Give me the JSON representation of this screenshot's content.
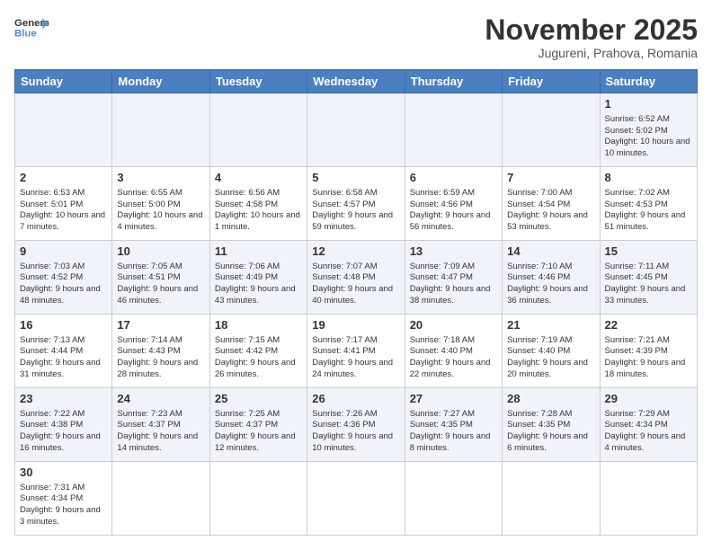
{
  "header": {
    "logo_general": "General",
    "logo_blue": "Blue",
    "month_title": "November 2025",
    "location": "Jugureni, Prahova, Romania"
  },
  "weekdays": [
    "Sunday",
    "Monday",
    "Tuesday",
    "Wednesday",
    "Thursday",
    "Friday",
    "Saturday"
  ],
  "weeks": [
    [
      {
        "day": "",
        "info": ""
      },
      {
        "day": "",
        "info": ""
      },
      {
        "day": "",
        "info": ""
      },
      {
        "day": "",
        "info": ""
      },
      {
        "day": "",
        "info": ""
      },
      {
        "day": "",
        "info": ""
      },
      {
        "day": "1",
        "info": "Sunrise: 6:52 AM\nSunset: 5:02 PM\nDaylight: 10 hours and 10 minutes."
      }
    ],
    [
      {
        "day": "2",
        "info": "Sunrise: 6:53 AM\nSunset: 5:01 PM\nDaylight: 10 hours and 7 minutes."
      },
      {
        "day": "3",
        "info": "Sunrise: 6:55 AM\nSunset: 5:00 PM\nDaylight: 10 hours and 4 minutes."
      },
      {
        "day": "4",
        "info": "Sunrise: 6:56 AM\nSunset: 4:58 PM\nDaylight: 10 hours and 1 minute."
      },
      {
        "day": "5",
        "info": "Sunrise: 6:58 AM\nSunset: 4:57 PM\nDaylight: 9 hours and 59 minutes."
      },
      {
        "day": "6",
        "info": "Sunrise: 6:59 AM\nSunset: 4:56 PM\nDaylight: 9 hours and 56 minutes."
      },
      {
        "day": "7",
        "info": "Sunrise: 7:00 AM\nSunset: 4:54 PM\nDaylight: 9 hours and 53 minutes."
      },
      {
        "day": "8",
        "info": "Sunrise: 7:02 AM\nSunset: 4:53 PM\nDaylight: 9 hours and 51 minutes."
      }
    ],
    [
      {
        "day": "9",
        "info": "Sunrise: 7:03 AM\nSunset: 4:52 PM\nDaylight: 9 hours and 48 minutes."
      },
      {
        "day": "10",
        "info": "Sunrise: 7:05 AM\nSunset: 4:51 PM\nDaylight: 9 hours and 46 minutes."
      },
      {
        "day": "11",
        "info": "Sunrise: 7:06 AM\nSunset: 4:49 PM\nDaylight: 9 hours and 43 minutes."
      },
      {
        "day": "12",
        "info": "Sunrise: 7:07 AM\nSunset: 4:48 PM\nDaylight: 9 hours and 40 minutes."
      },
      {
        "day": "13",
        "info": "Sunrise: 7:09 AM\nSunset: 4:47 PM\nDaylight: 9 hours and 38 minutes."
      },
      {
        "day": "14",
        "info": "Sunrise: 7:10 AM\nSunset: 4:46 PM\nDaylight: 9 hours and 36 minutes."
      },
      {
        "day": "15",
        "info": "Sunrise: 7:11 AM\nSunset: 4:45 PM\nDaylight: 9 hours and 33 minutes."
      }
    ],
    [
      {
        "day": "16",
        "info": "Sunrise: 7:13 AM\nSunset: 4:44 PM\nDaylight: 9 hours and 31 minutes."
      },
      {
        "day": "17",
        "info": "Sunrise: 7:14 AM\nSunset: 4:43 PM\nDaylight: 9 hours and 28 minutes."
      },
      {
        "day": "18",
        "info": "Sunrise: 7:15 AM\nSunset: 4:42 PM\nDaylight: 9 hours and 26 minutes."
      },
      {
        "day": "19",
        "info": "Sunrise: 7:17 AM\nSunset: 4:41 PM\nDaylight: 9 hours and 24 minutes."
      },
      {
        "day": "20",
        "info": "Sunrise: 7:18 AM\nSunset: 4:40 PM\nDaylight: 9 hours and 22 minutes."
      },
      {
        "day": "21",
        "info": "Sunrise: 7:19 AM\nSunset: 4:40 PM\nDaylight: 9 hours and 20 minutes."
      },
      {
        "day": "22",
        "info": "Sunrise: 7:21 AM\nSunset: 4:39 PM\nDaylight: 9 hours and 18 minutes."
      }
    ],
    [
      {
        "day": "23",
        "info": "Sunrise: 7:22 AM\nSunset: 4:38 PM\nDaylight: 9 hours and 16 minutes."
      },
      {
        "day": "24",
        "info": "Sunrise: 7:23 AM\nSunset: 4:37 PM\nDaylight: 9 hours and 14 minutes."
      },
      {
        "day": "25",
        "info": "Sunrise: 7:25 AM\nSunset: 4:37 PM\nDaylight: 9 hours and 12 minutes."
      },
      {
        "day": "26",
        "info": "Sunrise: 7:26 AM\nSunset: 4:36 PM\nDaylight: 9 hours and 10 minutes."
      },
      {
        "day": "27",
        "info": "Sunrise: 7:27 AM\nSunset: 4:35 PM\nDaylight: 9 hours and 8 minutes."
      },
      {
        "day": "28",
        "info": "Sunrise: 7:28 AM\nSunset: 4:35 PM\nDaylight: 9 hours and 6 minutes."
      },
      {
        "day": "29",
        "info": "Sunrise: 7:29 AM\nSunset: 4:34 PM\nDaylight: 9 hours and 4 minutes."
      }
    ],
    [
      {
        "day": "30",
        "info": "Sunrise: 7:31 AM\nSunset: 4:34 PM\nDaylight: 9 hours and 3 minutes."
      },
      {
        "day": "",
        "info": ""
      },
      {
        "day": "",
        "info": ""
      },
      {
        "day": "",
        "info": ""
      },
      {
        "day": "",
        "info": ""
      },
      {
        "day": "",
        "info": ""
      },
      {
        "day": "",
        "info": ""
      }
    ]
  ]
}
